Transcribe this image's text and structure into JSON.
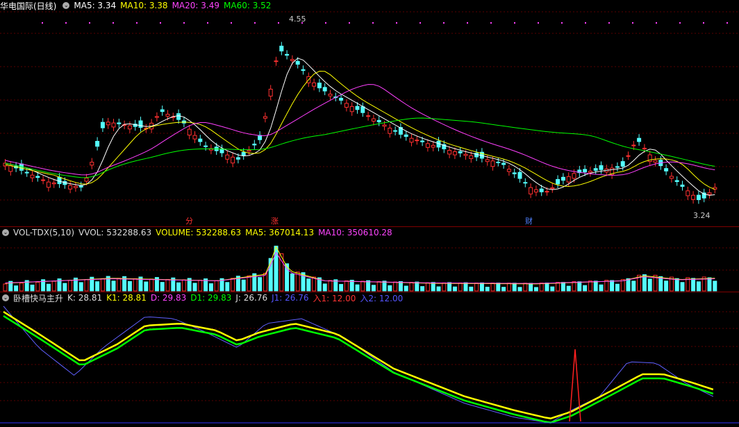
{
  "price_panel": {
    "title": "华电国际(日线)",
    "indicators": [
      {
        "label": "MA5: 3.34",
        "color": "#ffffff"
      },
      {
        "label": "MA10: 3.38",
        "color": "#ffff00"
      },
      {
        "label": "MA20: 3.49",
        "color": "#ff40ff"
      },
      {
        "label": "MA60: 3.52",
        "color": "#00ff00"
      }
    ],
    "high_label": "4.55",
    "low_label": "3.24",
    "markers": [
      {
        "text": "分",
        "color": "#ff3030"
      },
      {
        "text": "涨",
        "color": "#ff3030"
      },
      {
        "text": "财",
        "color": "#5080ff"
      }
    ],
    "chart_data": {
      "type": "candlestick",
      "y_high": 4.55,
      "y_low": 3.24,
      "ma5": 3.34,
      "ma10": 3.38,
      "ma20": 3.49,
      "ma60": 3.52
    }
  },
  "volume_panel": {
    "title": "VOL-TDX(5,10)",
    "indicators": [
      {
        "label": "VVOL: 532288.63",
        "color": "#dddddd"
      },
      {
        "label": "VOLUME: 532288.63",
        "color": "#ffff00"
      },
      {
        "label": "MA5: 367014.13",
        "color": "#ffff00"
      },
      {
        "label": "MA10: 350610.28",
        "color": "#ff40ff"
      }
    ]
  },
  "kd_panel": {
    "title": "卧槽快马主升",
    "indicators": [
      {
        "label": "K: 28.81",
        "color": "#dddddd"
      },
      {
        "label": "K1: 28.81",
        "color": "#ffff00"
      },
      {
        "label": "D: 29.83",
        "color": "#ff40ff"
      },
      {
        "label": "D1: 29.83",
        "color": "#00ff00"
      },
      {
        "label": "J: 26.76",
        "color": "#dddddd"
      },
      {
        "label": "J1: 26.76",
        "color": "#5050ff"
      },
      {
        "label": "入1: 12.00",
        "color": "#ff3030"
      },
      {
        "label": "入2: 12.00",
        "color": "#5050ff"
      }
    ]
  }
}
